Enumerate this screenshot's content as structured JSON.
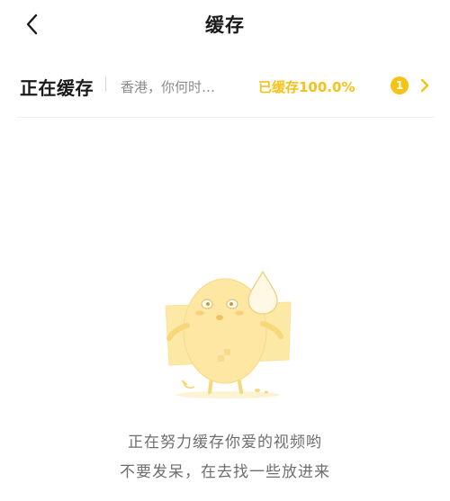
{
  "header": {
    "title": "缓存",
    "back_icon": "chevron-left-icon"
  },
  "caching": {
    "label": "正在缓存",
    "video_title": "香港，你何时…",
    "progress_text": "已缓存100.0%",
    "count_badge": "1",
    "chevron_icon": "chevron-right-icon"
  },
  "empty_state": {
    "illustration": "sweating-potato-mascot",
    "line1": "正在努力缓存你爱的视频哟",
    "line2": "不要发呆，在去找一些放进来"
  },
  "colors": {
    "accent": "#f6c219",
    "title_text": "#1a1a1a",
    "secondary_text": "#8a8a8a",
    "empty_text": "#6e6e6e"
  }
}
